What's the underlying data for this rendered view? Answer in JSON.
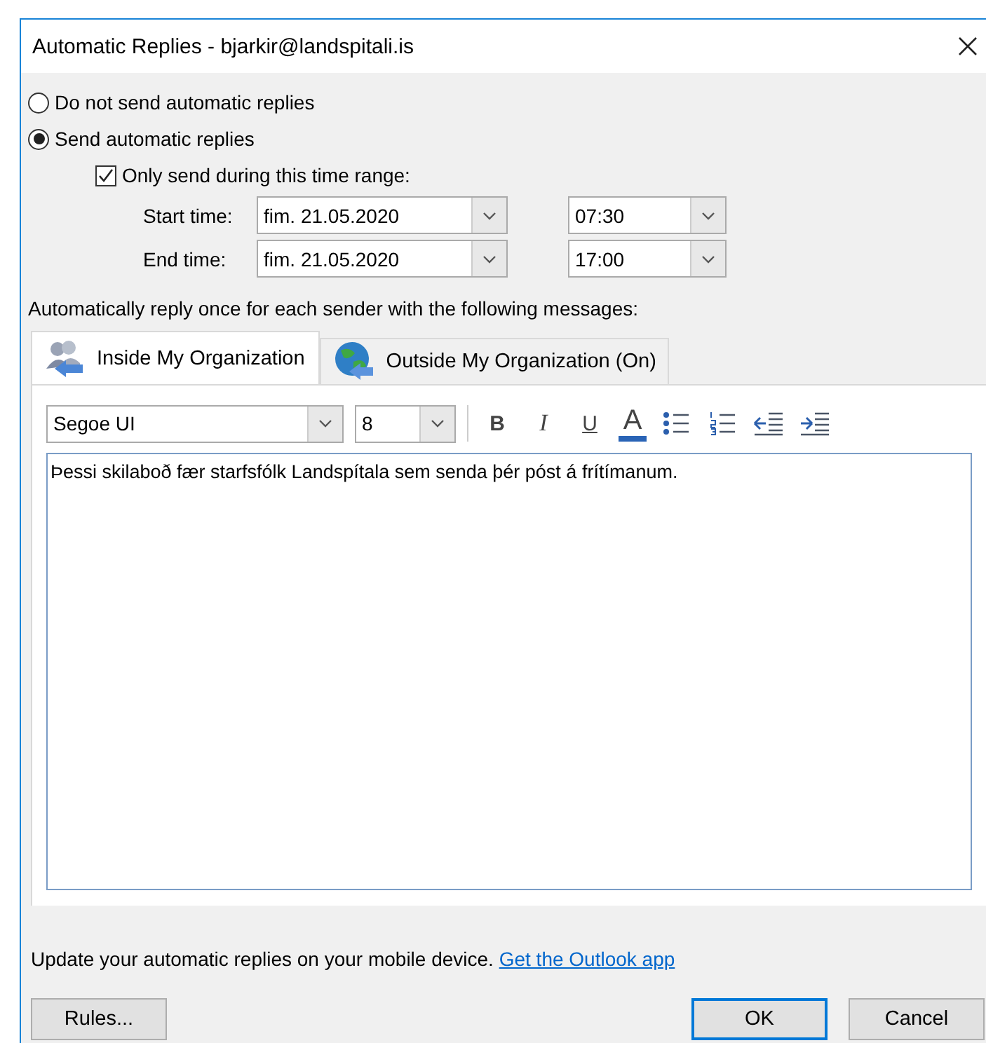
{
  "window": {
    "title": "Automatic Replies - bjarkir@landspitali.is"
  },
  "reply_mode": [
    {
      "label": "Do not send automatic replies",
      "selected": false
    },
    {
      "label": "Send automatic replies",
      "selected": true
    }
  ],
  "time_range": {
    "label": "Only send during this time range:",
    "checked": true,
    "rows": [
      {
        "label": "Start time:",
        "date": "fim. 21.05.2020",
        "time": "07:30"
      },
      {
        "label": "End time:",
        "date": "fim. 21.05.2020",
        "time": "17:00"
      }
    ]
  },
  "instructions": "Automatically reply once for each sender with the following messages:",
  "tabs": [
    {
      "label": "Inside My Organization",
      "selected": true,
      "kind": "people"
    },
    {
      "label": "Outside My Organization (On)",
      "selected": false,
      "kind": "globe"
    }
  ],
  "toolbar": {
    "font": "Segoe UI",
    "size": "8",
    "buttons": [
      {
        "kind": "bold",
        "label": "B"
      },
      {
        "kind": "italic",
        "label": "I"
      },
      {
        "kind": "underline",
        "label": "U"
      },
      {
        "kind": "color",
        "label": "A"
      },
      {
        "kind": "bullets"
      },
      {
        "kind": "numbering"
      },
      {
        "kind": "outdent"
      },
      {
        "kind": "indent"
      }
    ]
  },
  "message": "Þessi skilaboð fær starfsfólk Landspítala sem senda þér póst á frítímanum.",
  "mobile": {
    "text": "Update your automatic replies on your mobile device.",
    "link": "Get the Outlook app"
  },
  "buttons": [
    {
      "label": "Rules...",
      "kind": "rules",
      "default": false
    },
    {
      "label": "OK",
      "kind": "ok",
      "default": true
    },
    {
      "label": "Cancel",
      "kind": "cancel",
      "default": false
    }
  ]
}
